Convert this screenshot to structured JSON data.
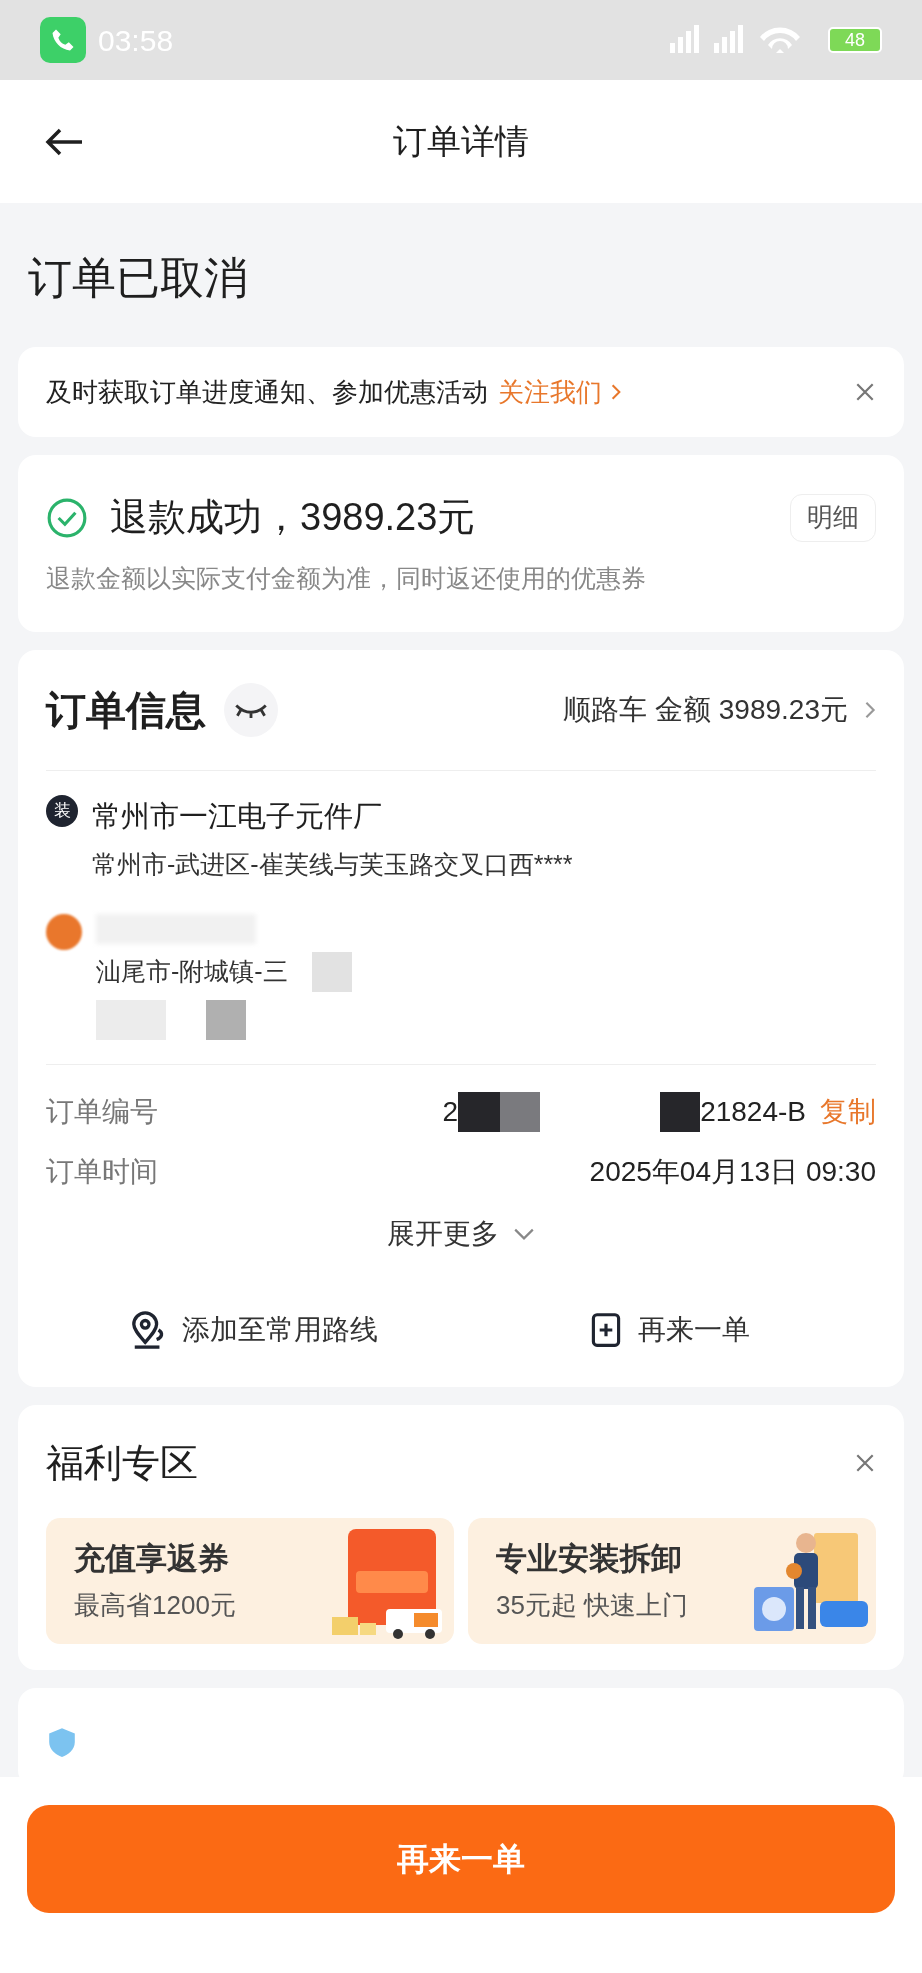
{
  "status_bar": {
    "time": "03:58",
    "battery": "48"
  },
  "header": {
    "title": "订单详情"
  },
  "status_title": "订单已取消",
  "notice": {
    "text": "及时获取订单进度通知、参加优惠活动",
    "link": "关注我们"
  },
  "refund": {
    "title": "退款成功，3989.23元",
    "note": "退款金额以实际支付金额为准，同时返还使用的优惠券",
    "detail_button": "明细"
  },
  "order_info": {
    "title": "订单信息",
    "summary": "顺路车 金额 3989.23元",
    "stops": [
      {
        "kind": "loading",
        "badge": "装",
        "name": "常州市一江电子元件厂",
        "address": "常州市-武进区-崔芙线与芙玉路交叉口西****"
      },
      {
        "kind": "unloading",
        "address": "汕尾市-附城镇-三"
      }
    ],
    "fields": [
      {
        "kind": "redacted",
        "label": "订单编号",
        "value_start": "2",
        "value_end": "21824-B",
        "action": "复制"
      },
      {
        "kind": "plain",
        "label": "订单时间",
        "value": "2025年04月13日 09:30"
      }
    ],
    "expand": "展开更多",
    "actions": [
      {
        "kind": "route",
        "label": "添加至常用路线"
      },
      {
        "kind": "reorder",
        "label": "再来一单"
      }
    ]
  },
  "welfare": {
    "title": "福利专区",
    "promos": [
      {
        "kind": "coupon",
        "title": "充值享返券",
        "subtitle": "最高省1200元"
      },
      {
        "kind": "install",
        "title": "专业安装拆卸",
        "subtitle": "35元起 快速上门"
      }
    ]
  },
  "bottom_button": "再来一单"
}
